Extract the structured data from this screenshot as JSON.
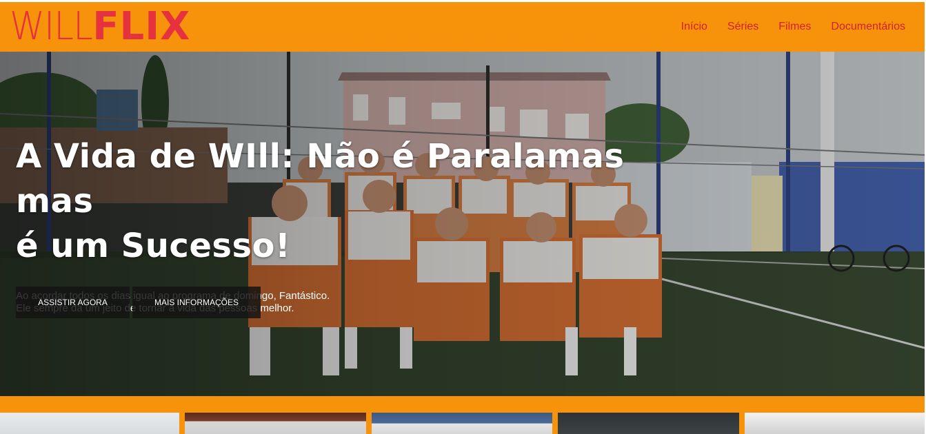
{
  "brand": {
    "logo_part1": "WILL",
    "logo_part2": "FLIX",
    "header_color": "#f7930a",
    "logo_color": "#e6313f"
  },
  "nav": {
    "items": [
      {
        "label": "Início"
      },
      {
        "label": "Séries"
      },
      {
        "label": "Filmes"
      },
      {
        "label": "Documentários"
      }
    ]
  },
  "hero": {
    "title_line1": "A Vida de WIll: Não é Paralamas mas",
    "title_line2": "é um Sucesso!",
    "description": "Ao acordar todos os dias igual ao programa de domingo, Fantástico. Ele sempre dá um jeito de tornar a vida das pessoas melhor.",
    "watch_button": "ASSISTIR AGORA",
    "info_button": "MAIS INFORMAÇÕES"
  },
  "thumbnails": {
    "count_visible": 5
  }
}
